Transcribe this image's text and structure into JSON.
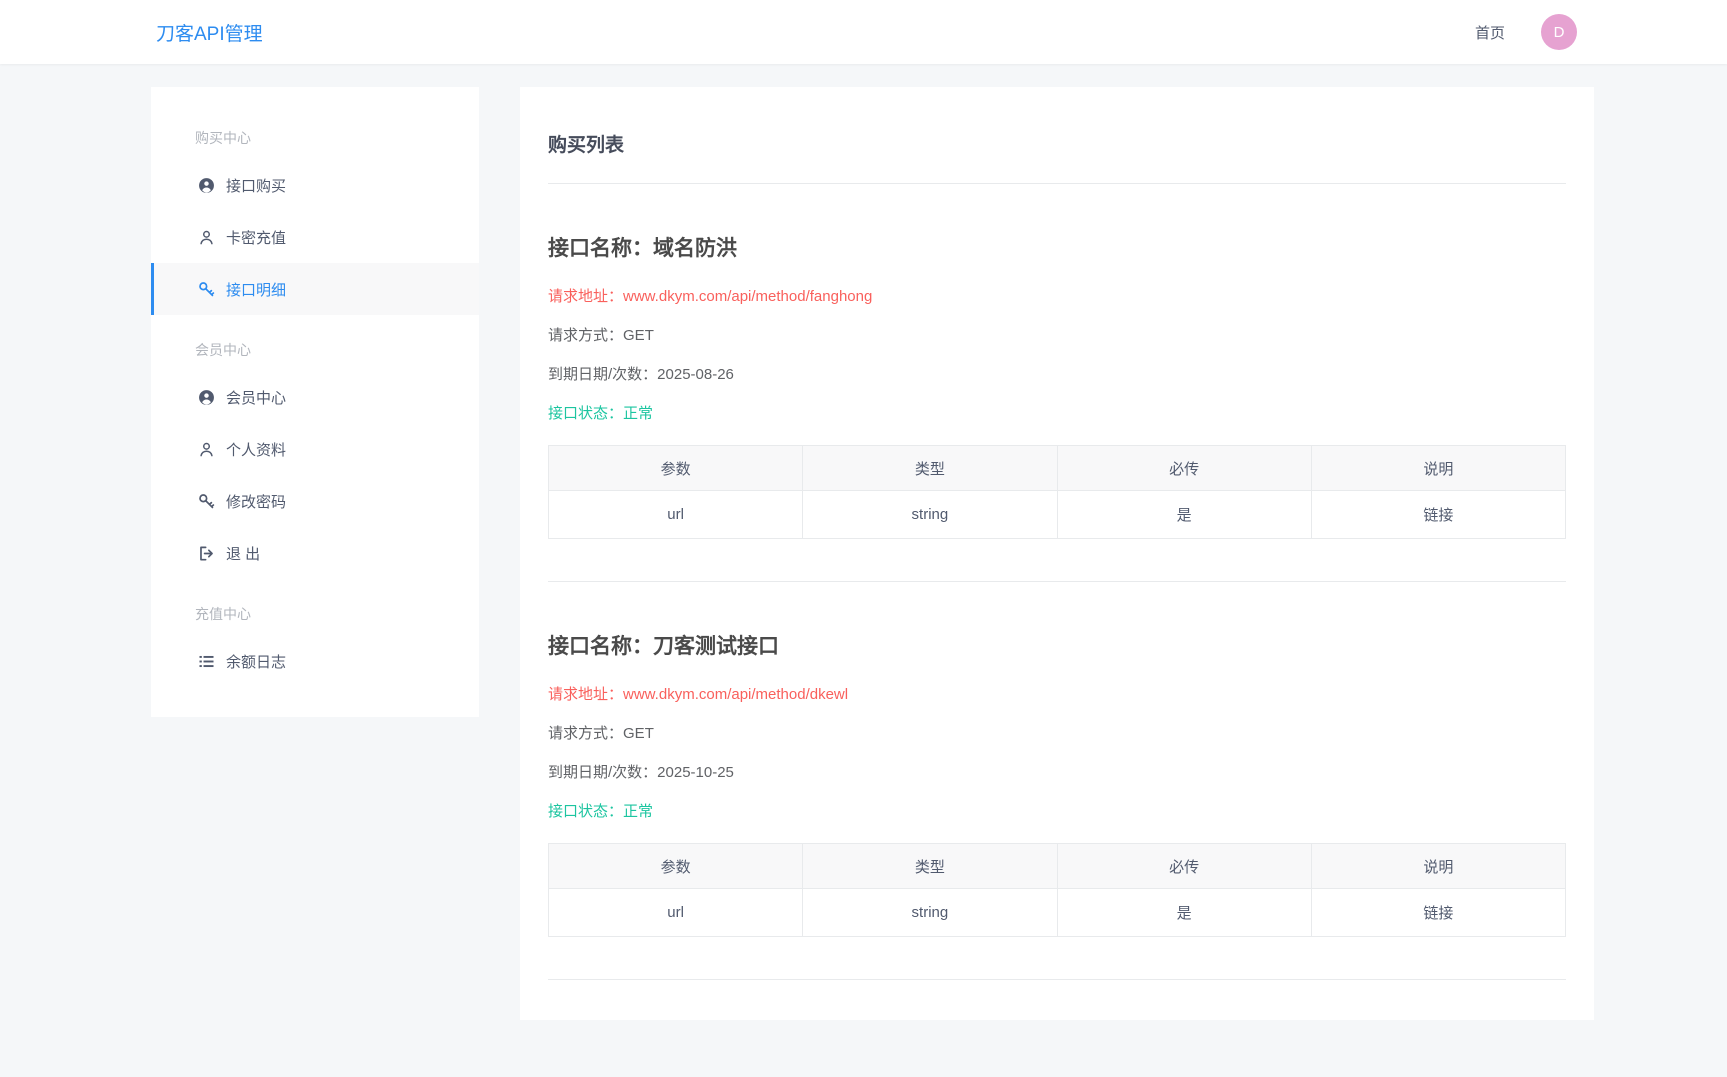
{
  "header": {
    "app_title": "刀客API管理",
    "nav_home": "首页",
    "avatar_text": "D"
  },
  "sidebar": {
    "groups": [
      {
        "title": "购买中心",
        "items": [
          {
            "label": "接口购买",
            "icon": "user-circle-icon",
            "active": false
          },
          {
            "label": "卡密充值",
            "icon": "user-outline-icon",
            "active": false
          },
          {
            "label": "接口明细",
            "icon": "key-icon",
            "active": true
          }
        ]
      },
      {
        "title": "会员中心",
        "items": [
          {
            "label": "会员中心",
            "icon": "user-circle-icon",
            "active": false
          },
          {
            "label": "个人资料",
            "icon": "user-outline-icon",
            "active": false
          },
          {
            "label": "修改密码",
            "icon": "key-icon",
            "active": false
          },
          {
            "label": "退 出",
            "icon": "logout-icon",
            "active": false
          }
        ]
      },
      {
        "title": "充值中心",
        "items": [
          {
            "label": "余额日志",
            "icon": "list-icon",
            "active": false
          }
        ]
      }
    ]
  },
  "main": {
    "page_title": "购买列表",
    "apis": [
      {
        "name_label": "接口名称：",
        "name": "域名防洪",
        "url_label": "请求地址：",
        "url": "www.dkym.com/api/method/fanghong",
        "method_label": "请求方式：",
        "method": "GET",
        "expire_label": "到期日期/次数：",
        "expire": "2025-08-26",
        "status_label": "接口状态：",
        "status": "正常",
        "params_table": {
          "headers": [
            "参数",
            "类型",
            "必传",
            "说明"
          ],
          "rows": [
            [
              "url",
              "string",
              "是",
              "链接"
            ]
          ]
        }
      },
      {
        "name_label": "接口名称：",
        "name": "刀客测试接口",
        "url_label": "请求地址：",
        "url": "www.dkym.com/api/method/dkewl",
        "method_label": "请求方式：",
        "method": "GET",
        "expire_label": "到期日期/次数：",
        "expire": "2025-10-25",
        "status_label": "接口状态：",
        "status": "正常",
        "params_table": {
          "headers": [
            "参数",
            "类型",
            "必传",
            "说明"
          ],
          "rows": [
            [
              "url",
              "string",
              "是",
              "链接"
            ]
          ]
        }
      }
    ]
  },
  "colors": {
    "primary_blue": "#2d8cf0",
    "danger_red": "#f9605c",
    "success_teal": "#1cc5a0",
    "avatar_pink": "#e6a2d1"
  }
}
